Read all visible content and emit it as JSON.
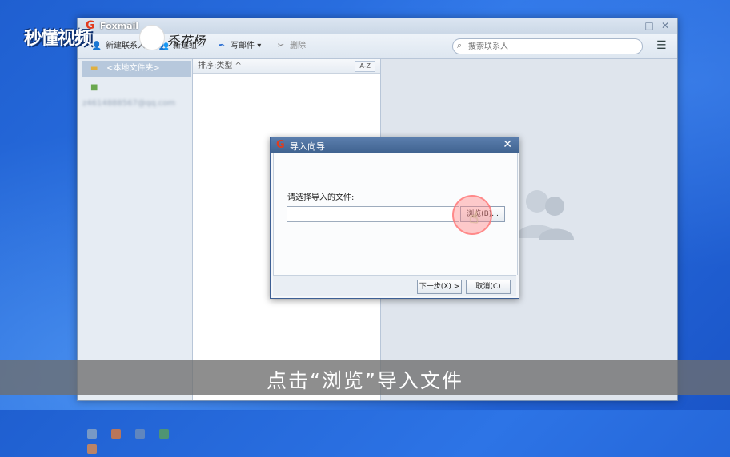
{
  "app": {
    "title": "Foxmail",
    "window_controls": {
      "minimize": "–",
      "maximize": "□",
      "close": "✕"
    }
  },
  "toolbar": {
    "new_contact": "新建联系人",
    "new_group": "新建组",
    "compose": "写邮件",
    "delete": "删除",
    "search_placeholder": "搜索联系人"
  },
  "folders": [
    {
      "label": "<本地文件夹>",
      "selected": true
    },
    {
      "label": "z4614888567@qq.com",
      "blurred": true
    }
  ],
  "list": {
    "sort_label": "排序:类型 ^",
    "sort_order": "A-Z"
  },
  "dialog": {
    "title": "导入向导",
    "close": "✕",
    "prompt": "请选择导入的文件:",
    "file_value": "",
    "browse_label": "浏览(B)...",
    "next_label": "下一步(X) >",
    "cancel_label": "取消(C)"
  },
  "watermark": {
    "brand": "秒懂视频",
    "signature": "秀花杨"
  },
  "caption": "点击“浏览”导入文件",
  "colors": {
    "desktop_blue": "#2d74e6",
    "dialog_title_blue": "#4a6d9d",
    "foxmail_red": "#e23a1e"
  }
}
